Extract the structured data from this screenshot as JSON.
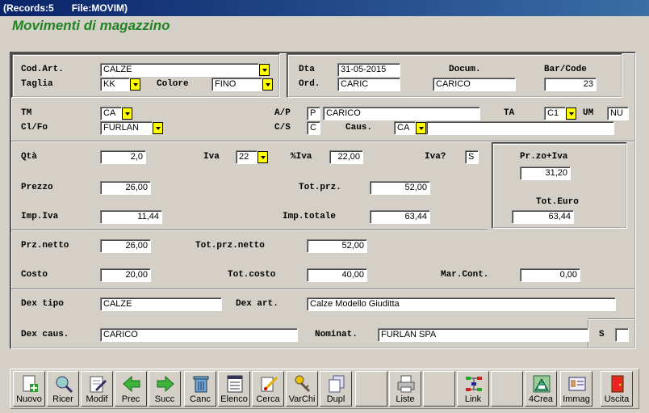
{
  "window": {
    "records": "(Records:5",
    "file": "File:MOVIM)"
  },
  "heading": "Movimenti di magazzino",
  "top_left": {
    "cod_art_label": "Cod.Art.",
    "cod_art_value": "CALZE",
    "taglia_label": "Taglia",
    "taglia_value": "KK",
    "colore_label": "Colore",
    "colore_value": "FINO"
  },
  "top_right": {
    "dta_label": "Dta",
    "dta_value": "31-05-2015",
    "docum_label": "Docum.",
    "barcode_label": "Bar/Code",
    "ord_label": "Ord.",
    "ord_value": "CARIC",
    "docum_value": "CARICO",
    "barcode_value": "23"
  },
  "mid": {
    "tm_label": "TM",
    "tm_value": "CA",
    "ap_label": "A/P",
    "ap_value": "P",
    "ap_desc": "CARICO",
    "ta_label": "TA",
    "ta_value": "C1",
    "um_label": "UM",
    "um_value": "NU",
    "clfo_label": "Cl/Fo",
    "clfo_value": "FURLAN",
    "cs_label": "C/S",
    "cs_value": "C",
    "caus_label": "Caus.",
    "caus_value": "CA",
    "caus_desc": ""
  },
  "amounts": {
    "qta_label": "Qtà",
    "qta_value": "2,0",
    "iva_label": "Iva",
    "iva_value": "22",
    "piva_label": "%Iva",
    "piva_value": "22,00",
    "ivaq_label": "Iva?",
    "ivaq_value": "S",
    "przoiva_label": "Pr.zo+Iva",
    "przoiva_value": "31,20",
    "prezzo_label": "Prezzo",
    "prezzo_value": "26,00",
    "totprz_label": "Tot.prz.",
    "totprz_value": "52,00",
    "toteuro_label": "Tot.Euro",
    "toteuro_value": "63,44",
    "impiva_label": "Imp.Iva",
    "impiva_value": "11,44",
    "imptot_label": "Imp.totale",
    "imptot_value": "63,44",
    "prznetto_label": "Prz.netto",
    "prznetto_value": "26,00",
    "totprznetto_label": "Tot.prz.netto",
    "totprznetto_value": "52,00",
    "costo_label": "Costo",
    "costo_value": "20,00",
    "totcosto_label": "Tot.costo",
    "totcosto_value": "40,00",
    "marcont_label": "Mar.Cont.",
    "marcont_value": "0,00"
  },
  "desc": {
    "dextipo_label": "Dex tipo",
    "dextipo_value": "CALZE",
    "dexart_label": "Dex art.",
    "dexart_value": "Calze Modello Giuditta",
    "dexcaus_label": "Dex caus.",
    "dexcaus_value": "CARICO",
    "nominat_label": "Nominat.",
    "nominat_value": "FURLAN SPA",
    "s_label": "S",
    "s_value": ""
  },
  "toolbar": [
    {
      "label": "Nuovo",
      "icon": "new-icon"
    },
    {
      "label": "Ricer",
      "icon": "search-icon"
    },
    {
      "label": "Modif",
      "icon": "edit-icon"
    },
    {
      "label": "Prec",
      "icon": "arrow-left-icon"
    },
    {
      "label": "Succ",
      "icon": "arrow-right-icon"
    },
    {
      "label": "Canc",
      "icon": "trash-icon"
    },
    {
      "label": "Elenco",
      "icon": "list-icon"
    },
    {
      "label": "Cerca",
      "icon": "find-icon"
    },
    {
      "label": "VarChi",
      "icon": "keys-icon"
    },
    {
      "label": "Dupl",
      "icon": "duplicate-icon"
    },
    {
      "label": "Liste",
      "icon": "printer-icon"
    },
    {
      "label": "Link",
      "icon": "link-icon"
    },
    {
      "label": "4Crea",
      "icon": "create-icon"
    },
    {
      "label": "Immag",
      "icon": "image-icon"
    },
    {
      "label": "Uscita",
      "icon": "exit-icon"
    }
  ]
}
